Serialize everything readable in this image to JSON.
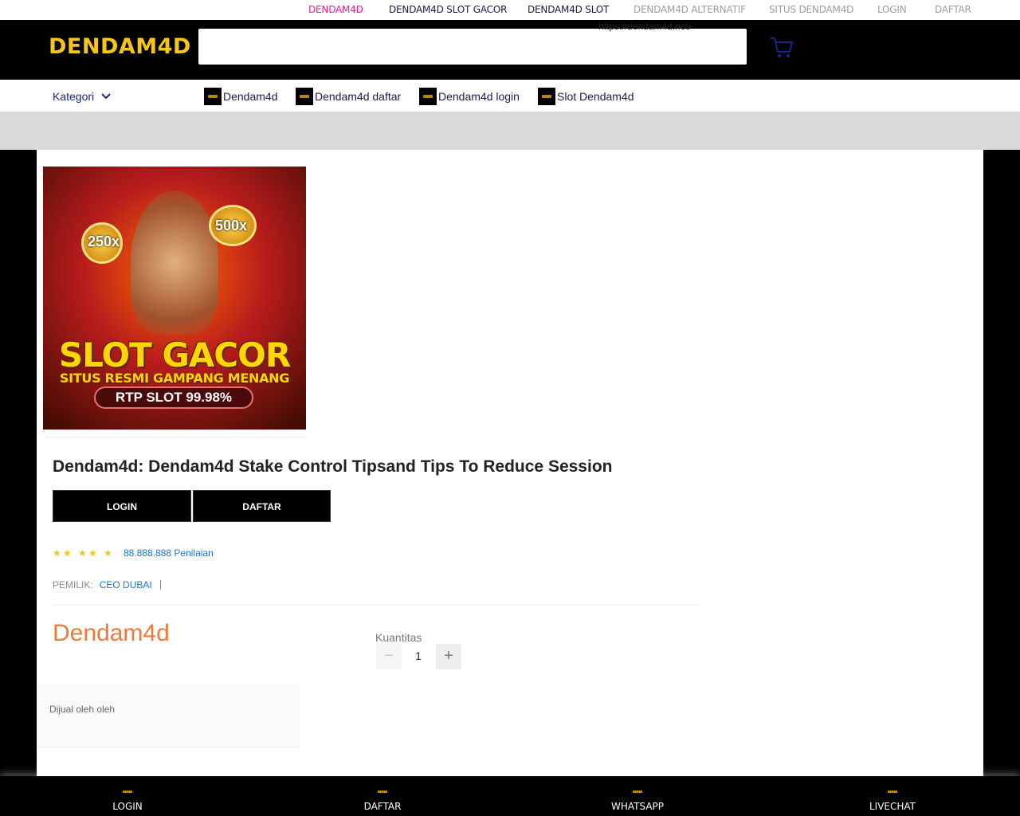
{
  "top_links": [
    {
      "label": "DENDAM4D",
      "color": "#e91e8c"
    },
    {
      "label": "DENDAM4D SLOT GACOR",
      "color": "#1a1a4e"
    },
    {
      "label": "DENDAM4D SLOT",
      "color": "#1a1a4e"
    },
    {
      "label": "DENDAM4D ALTERNATIF",
      "color": "#9e9e9e"
    },
    {
      "label": "SITUS DENDAM4D",
      "color": "#9e9e9e"
    },
    {
      "label": "LOGIN",
      "color": "#9e9e9e"
    },
    {
      "label": "DAFTAR",
      "color": "#9e9e9e"
    }
  ],
  "header": {
    "brand": "DENDAM4D",
    "search_value": "https://dendam4d.net/"
  },
  "nav": {
    "kategori": "Kategori",
    "items": [
      "Dendam4d",
      "Dendam4d daftar",
      "Dendam4d login",
      "Slot Dendam4d"
    ]
  },
  "product": {
    "image": {
      "coin_left": "250x",
      "coin_right": "500x",
      "headline": "SLOT GACOR",
      "subline": "SITUS RESMI GAMPANG MENANG",
      "rtp": "RTP SLOT 99.98%"
    },
    "title": "Dendam4d: Dendam4d Stake Control Tipsand Tips To Reduce Session",
    "login_label": "LOGIN",
    "daftar_label": "DAFTAR",
    "rating_stars": 5,
    "rating_text": "88.888.888 Penilaian",
    "owner_label": "PEMILIK:",
    "owner_value": "CEO DUBAI",
    "price": "Dendam4d",
    "quantity_label": "Kuantitas",
    "quantity": "1",
    "seller_text": "Dijual oleh oleh"
  },
  "bottom_nav": [
    "LOGIN",
    "DAFTAR",
    "WHATSAPP",
    "LIVECHAT"
  ],
  "colors": {
    "brand": "#f5c518",
    "accent_price": "#ee7a3a",
    "link_blue": "#1976d2"
  }
}
